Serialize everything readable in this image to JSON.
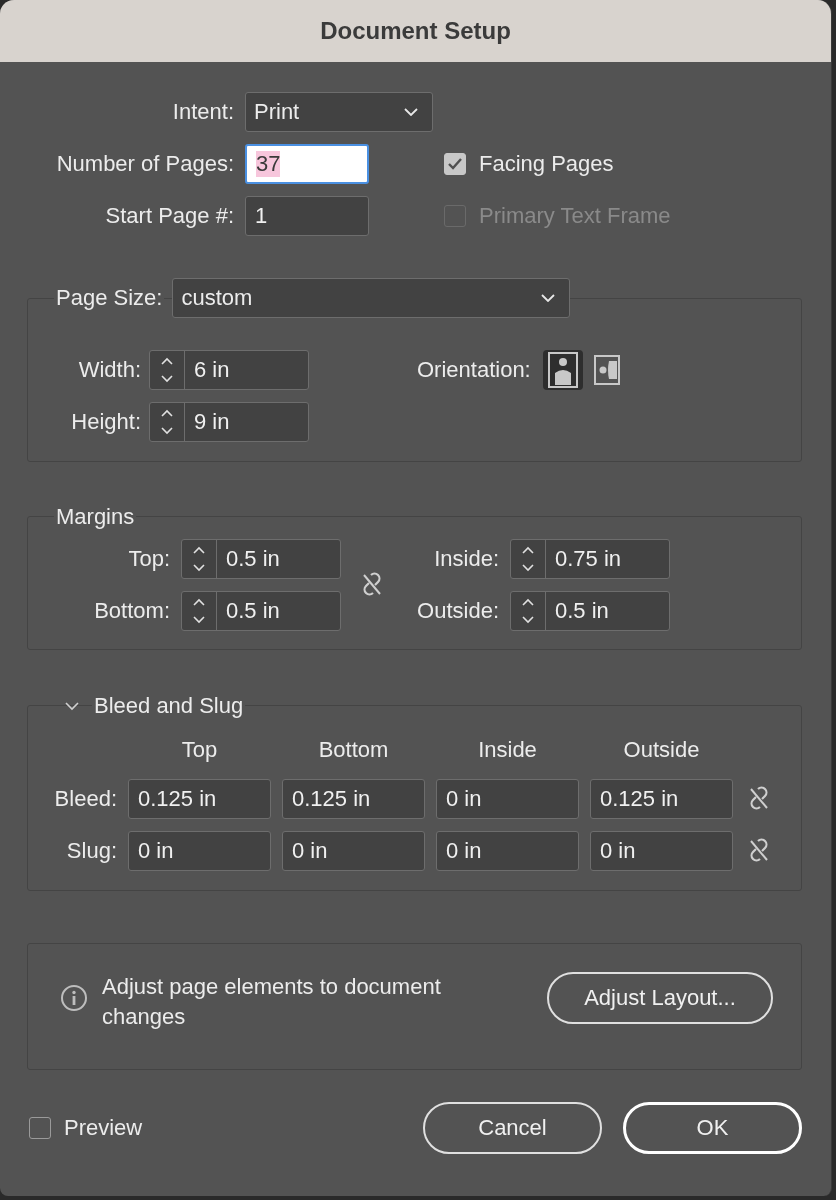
{
  "window": {
    "title": "Document Setup"
  },
  "intent": {
    "label": "Intent:",
    "value": "Print"
  },
  "number_of_pages": {
    "label": "Number of Pages:",
    "value": "37",
    "focused": true
  },
  "start_page": {
    "label": "Start Page #:",
    "value": "1"
  },
  "facing_pages": {
    "label": "Facing Pages",
    "checked": true,
    "disabled": false
  },
  "primary_text_frame": {
    "label": "Primary Text Frame",
    "checked": false,
    "disabled": true
  },
  "page_size": {
    "label": "Page Size:",
    "value": "custom",
    "width": {
      "label": "Width:",
      "value": "6 in"
    },
    "height": {
      "label": "Height:",
      "value": "9 in"
    },
    "orientation": {
      "label": "Orientation:",
      "options": [
        {
          "kind": "portrait",
          "selected": true
        },
        {
          "kind": "landscape",
          "selected": false
        }
      ]
    }
  },
  "margins": {
    "title": "Margins",
    "linked": false,
    "fields": [
      {
        "label": "Top:",
        "value": "0.5 in"
      },
      {
        "label": "Bottom:",
        "value": "0.5 in"
      },
      {
        "label": "Inside:",
        "value": "0.75 in"
      },
      {
        "label": "Outside:",
        "value": "0.5 in"
      }
    ]
  },
  "bleed_and_slug": {
    "title": "Bleed and Slug",
    "expanded": true,
    "columns": [
      "Top",
      "Bottom",
      "Inside",
      "Outside"
    ],
    "rows": [
      {
        "label": "Bleed:",
        "values": [
          "0.125 in",
          "0.125 in",
          "0 in",
          "0.125 in"
        ],
        "linked": false
      },
      {
        "label": "Slug:",
        "values": [
          "0 in",
          "0 in",
          "0 in",
          "0 in"
        ],
        "linked": false
      }
    ]
  },
  "info": {
    "text": "Adjust page elements to document changes",
    "button": "Adjust Layout..."
  },
  "preview": {
    "label": "Preview",
    "checked": false
  },
  "buttons": [
    {
      "label": "Cancel",
      "kind": "normal"
    },
    {
      "label": "OK",
      "kind": "default"
    }
  ]
}
